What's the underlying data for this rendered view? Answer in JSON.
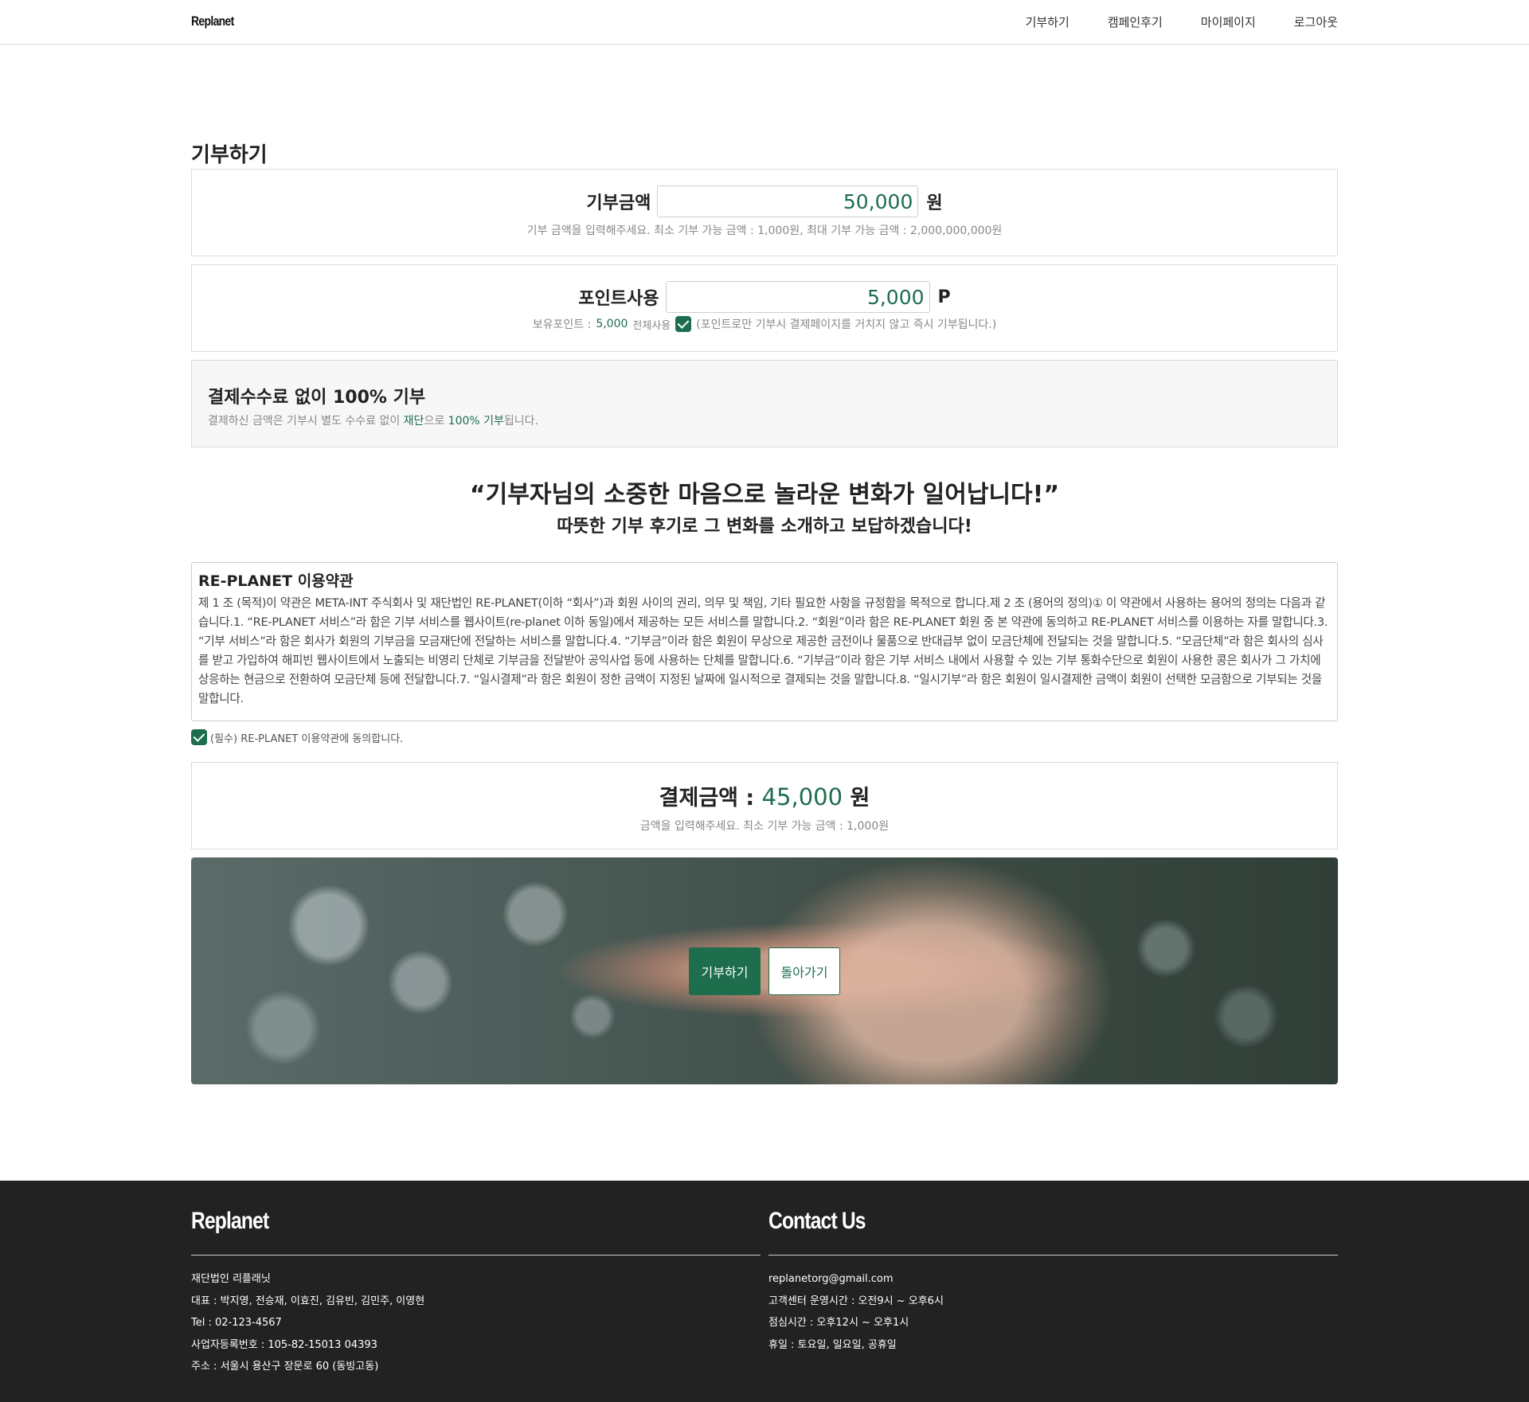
{
  "header": {
    "logo": "Replanet",
    "nav": [
      "기부하기",
      "캠페인후기",
      "마이페이지",
      "로그아웃"
    ]
  },
  "page_title": "기부하기",
  "donation": {
    "label": "기부금액",
    "value": "50,000",
    "unit": "원",
    "hint": "기부 금액을 입력해주세요. 최소 기부 가능 금액 : 1,000원, 최대 기부 가능 금액 : 2,000,000,000원"
  },
  "points": {
    "label": "포인트사용",
    "value": "5,000",
    "unit": "P",
    "owned_label": "보유포인트 :",
    "owned_value": "5,000",
    "use_all_label": "전체사용",
    "note": "(포인트로만 기부시 결제페이지를 거치지 않고 즉시 기부됩니다.)"
  },
  "fee": {
    "title": "결제수수료 없이 100% 기부",
    "desc_prefix": "결제하신 금액은 기부시 별도 수수료 없이 ",
    "desc_highlight1": "재단",
    "desc_mid": "으로 ",
    "desc_highlight2": "100% 기부",
    "desc_suffix": "됩니다."
  },
  "quote": {
    "line1": "“기부자님의 소중한 마음으로 놀라운 변화가 일어납니다!”",
    "line2": "따뜻한 기부 후기로 그 변화를 소개하고 보답하겠습니다!"
  },
  "terms": {
    "title": "RE-PLANET 이용약관",
    "body": "제 1 조 (목적)이 약관은 META-INT 주식회사 및 재단법인 RE-PLANET(이하 “회사”)과 회원 사이의 권리, 의무 및 책임, 기타 필요한 사항을 규정함을 목적으로 합니다.제 2 조 (용어의 정의)① 이 약관에서 사용하는 용어의 정의는 다음과 같습니다.1. “RE-PLANET 서비스”라 함은 기부 서비스를 웹사이트(re-planet 이하 동일)에서 제공하는 모든 서비스를 말합니다.2. “회원”이라 함은 RE-PLANET 회원 중 본 약관에 동의하고 RE-PLANET 서비스를 이용하는 자를 말합니다.3. “기부 서비스”라 함은 회사가 회원의 기부금을 모금재단에 전달하는 서비스를 말합니다.4. “기부금”이라 함은 회원이 무상으로 제공한 금전이나 물품으로 반대급부 없이 모금단체에 전달되는 것을 말합니다.5. “모금단체”라 함은 회사의 심사를 받고 가입하여 해피빈 웹사이트에서 노출되는 비영리 단체로 기부금을 전달받아 공익사업 등에 사용하는 단체를 말합니다.6. “기부금”이라 함은 기부 서비스 내에서 사용할 수 있는 기부 통화수단으로 회원이 사용한 콩은 회사가 그 가치에 상응하는 현금으로 전환하여 모금단체 등에 전달합니다.7. “일시결제”라 함은 회원이 정한 금액이 지정된 날짜에 일시적으로 결제되는 것을 말합니다.8. “일시기부”라 함은 회원이 일시결제한 금액이 회원이 선택한 모금함으로 기부되는 것을 말합니다."
  },
  "agree_label": "(필수) RE-PLANET 이용약관에 동의합니다.",
  "payment": {
    "label": "결제금액 :",
    "value": "45,000",
    "unit": "원",
    "hint": "금액을 입력해주세요. 최소 기부 가능 금액 : 1,000원"
  },
  "buttons": {
    "donate": "기부하기",
    "back": "돌아가기"
  },
  "footer": {
    "left": {
      "title": "Replanet",
      "lines": [
        "재단법인 리플래닛",
        "대표 : 박지영, 전승재, 이효진, 김유빈, 김민주, 이영현",
        "Tel : 02-123-4567",
        "사업자등록번호 : 105-82-15013 04393",
        "주소 : 서울시 용산구 장문로 60 (동빙고동)"
      ]
    },
    "right": {
      "title": "Contact Us",
      "lines": [
        "replanetorg@gmail.com",
        "고객센터 운영시간 : 오전9시 ~ 오후6시",
        "점심시간 : 오후12시 ~ 오후1시",
        "휴일 : 토요일, 일요일, 공휴일"
      ]
    }
  },
  "colors": {
    "accent": "#1e6e4e",
    "footer_bg": "#222222"
  }
}
